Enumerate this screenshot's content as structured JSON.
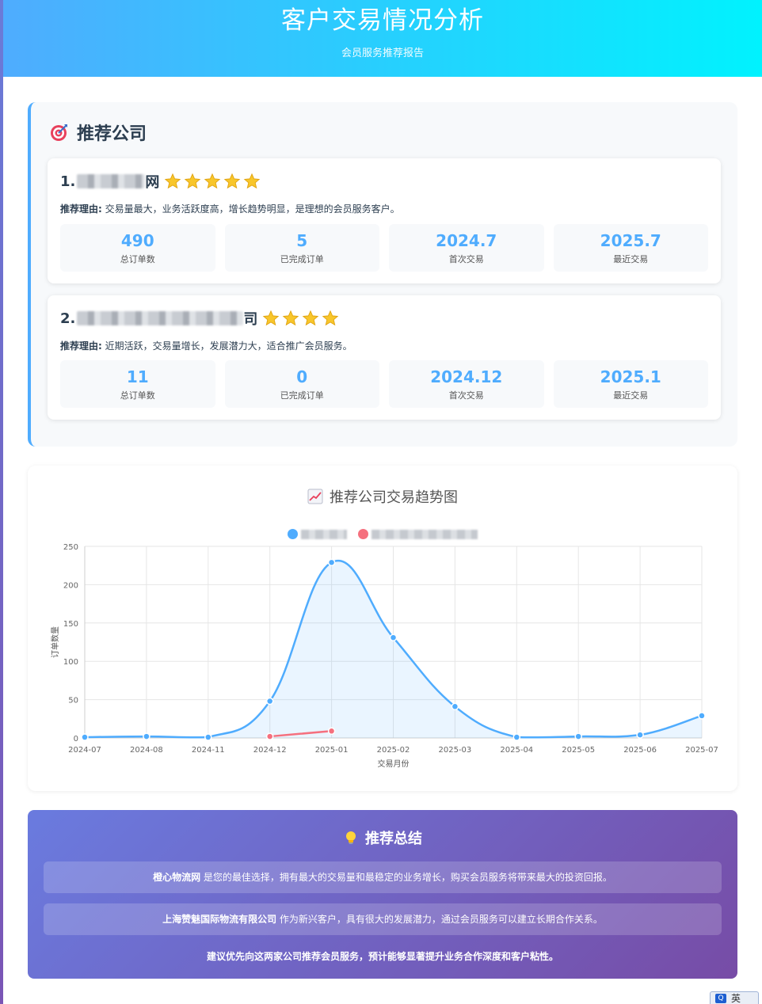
{
  "header": {
    "title": "客户交易情况分析",
    "subtitle": "会员服务推荐报告"
  },
  "recommend": {
    "heading": "推荐公司",
    "reason_label": "推荐理由:",
    "companies": [
      {
        "rank": "1.",
        "name_tail": "网",
        "stars": 5,
        "reason": "交易量最大，业务活跃度高，增长趋势明显，是理想的会员服务客户。",
        "stats": [
          {
            "value": "490",
            "label": "总订单数"
          },
          {
            "value": "5",
            "label": "已完成订单"
          },
          {
            "value": "2024.7",
            "label": "首次交易"
          },
          {
            "value": "2025.7",
            "label": "最近交易"
          }
        ]
      },
      {
        "rank": "2.",
        "name_tail": "司",
        "stars": 4,
        "reason": "近期活跃，交易量增长，发展潜力大，适合推广会员服务。",
        "stats": [
          {
            "value": "11",
            "label": "总订单数"
          },
          {
            "value": "0",
            "label": "已完成订单"
          },
          {
            "value": "2024.12",
            "label": "首次交易"
          },
          {
            "value": "2025.1",
            "label": "最近交易"
          }
        ]
      }
    ]
  },
  "chart": {
    "title": "推荐公司交易趋势图",
    "colors": {
      "series1": "#4facfe",
      "series2": "#f5707e"
    }
  },
  "chart_data": {
    "type": "line",
    "title": "推荐公司交易趋势图",
    "xlabel": "交易月份",
    "ylabel": "订单数量",
    "categories": [
      "2024-07",
      "2024-08",
      "2024-11",
      "2024-12",
      "2025-01",
      "2025-02",
      "2025-03",
      "2025-04",
      "2025-05",
      "2025-06",
      "2025-07"
    ],
    "ylim": [
      0,
      250
    ],
    "yticks": [
      0,
      50,
      100,
      150,
      200,
      250
    ],
    "grid": true,
    "legend_position": "top",
    "series": [
      {
        "values": [
          1,
          2,
          1,
          48,
          229,
          131,
          41,
          1,
          2,
          4,
          29
        ],
        "fill": true
      },
      {
        "values": [
          null,
          null,
          null,
          2,
          9,
          null,
          null,
          null,
          null,
          null,
          null
        ],
        "fill": false
      }
    ]
  },
  "summary": {
    "heading": "推荐总结",
    "line1_company": "橙心物流网",
    "line1_text": " 是您的最佳选择，拥有最大的交易量和最稳定的业务增长，购买会员服务将带来最大的投资回报。",
    "line2_company": "上海赞魅国际物流有限公司",
    "line2_text": " 作为新兴客户，具有很大的发展潜力，通过会员服务可以建立长期合作关系。",
    "final": "建议优先向这两家公司推荐会员服务，预计能够显著提升业务合作深度和客户粘性。"
  },
  "ime": {
    "label": "英"
  }
}
